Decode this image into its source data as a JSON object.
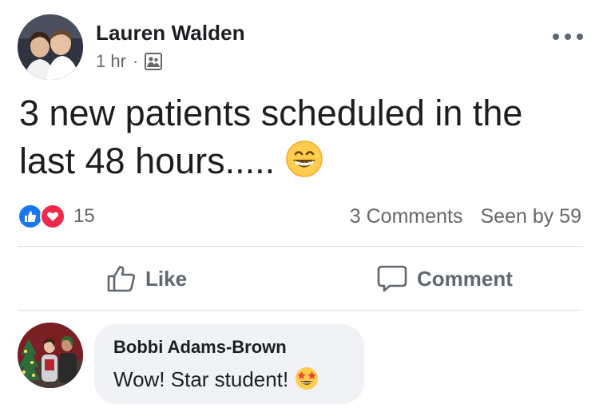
{
  "post": {
    "author_name": "Lauren Walden",
    "time_ago": "1 hr",
    "separator": "·",
    "audience_icon": "friends-icon",
    "more_icon": "ellipsis-icon",
    "text": "3 new patients scheduled in the last 48 hours.....",
    "text_emoji": "grinning-face-with-smiling-eyes-emoji"
  },
  "reactions": {
    "icons": [
      "like-reaction-icon",
      "love-reaction-icon"
    ],
    "count": "15",
    "comments_label": "3 Comments",
    "seen_by_label": "Seen by 59"
  },
  "actions": {
    "like_label": "Like",
    "comment_label": "Comment"
  },
  "comment": {
    "author_name": "Bobbi Adams-Brown",
    "text": "Wow! Star student!",
    "text_emoji": "star-struck-emoji"
  },
  "colors": {
    "like_blue": "#1877f2",
    "love_red": "#f02849",
    "secondary_text": "#65676b",
    "bubble_bg": "#f0f2f5"
  }
}
